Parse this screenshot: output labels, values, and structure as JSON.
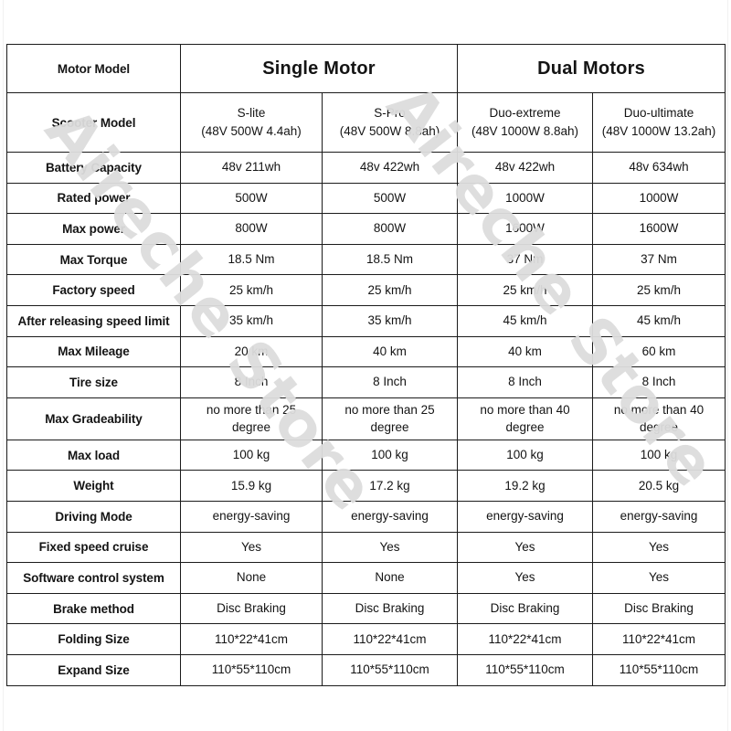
{
  "watermark": {
    "text_a": "Aireche Store",
    "text_b": "Aireche Store",
    "color": "#dddddd"
  },
  "table": {
    "columns": {
      "label_header": "Motor Model",
      "groups": [
        {
          "name": "Single Motor",
          "span": 2
        },
        {
          "name": "Dual Motors",
          "span": 2
        }
      ],
      "scooter_label": "Scooter Model",
      "scooter_models": [
        "S-lite\n(48V 500W 4.4ah)",
        "S-Pro\n(48V 500W 8.8ah)",
        "Duo-extreme\n(48V 1000W  8.8ah)",
        "Duo-ultimate\n(48V 1000W 13.2ah)"
      ]
    },
    "rows": [
      {
        "label": "Battery Capacity",
        "values": [
          "48v 211wh",
          "48v 422wh",
          "48v 422wh",
          "48v 634wh"
        ]
      },
      {
        "label": "Rated power",
        "values": [
          "500W",
          "500W",
          "1000W",
          "1000W"
        ]
      },
      {
        "label": "Max power",
        "values": [
          "800W",
          "800W",
          "1600W",
          "1600W"
        ]
      },
      {
        "label": "Max Torque",
        "values": [
          "18.5 Nm",
          "18.5 Nm",
          "37 Nm",
          "37 Nm"
        ]
      },
      {
        "label": "Factory speed",
        "values": [
          "25 km/h",
          "25 km/h",
          "25 km/h",
          "25 km/h"
        ]
      },
      {
        "label": "After releasing speed limit",
        "values": [
          "35 km/h",
          "35 km/h",
          "45 km/h",
          "45 km/h"
        ]
      },
      {
        "label": "Max Mileage",
        "values": [
          "20 km",
          "40 km",
          "40 km",
          "60 km"
        ]
      },
      {
        "label": "Tire size",
        "values": [
          "8 Inch",
          "8 Inch",
          "8 Inch",
          "8 Inch"
        ]
      },
      {
        "label": "Max Gradeability",
        "values": [
          "no more than 25\ndegree",
          "no more than 25\ndegree",
          "no more than 40\ndegree",
          "no more than 40\ndegree"
        ],
        "tall": true
      },
      {
        "label": "Max load",
        "values": [
          "100 kg",
          "100 kg",
          "100 kg",
          "100 kg"
        ]
      },
      {
        "label": "Weight",
        "values": [
          "15.9 kg",
          "17.2 kg",
          "19.2 kg",
          "20.5 kg"
        ]
      },
      {
        "label": "Driving Mode",
        "values": [
          "energy-saving",
          "energy-saving",
          "energy-saving",
          "energy-saving"
        ]
      },
      {
        "label": "Fixed speed cruise",
        "values": [
          "Yes",
          "Yes",
          "Yes",
          "Yes"
        ]
      },
      {
        "label": "Software control system",
        "values": [
          "None",
          "None",
          "Yes",
          "Yes"
        ]
      },
      {
        "label": "Brake method",
        "values": [
          "Disc Braking",
          "Disc Braking",
          "Disc Braking",
          "Disc Braking"
        ]
      },
      {
        "label": "Folding Size",
        "values": [
          "110*22*41cm",
          "110*22*41cm",
          "110*22*41cm",
          "110*22*41cm"
        ]
      },
      {
        "label": "Expand Size",
        "values": [
          "110*55*110cm",
          "110*55*110cm",
          "110*55*110cm",
          "110*55*110cm"
        ]
      }
    ]
  }
}
